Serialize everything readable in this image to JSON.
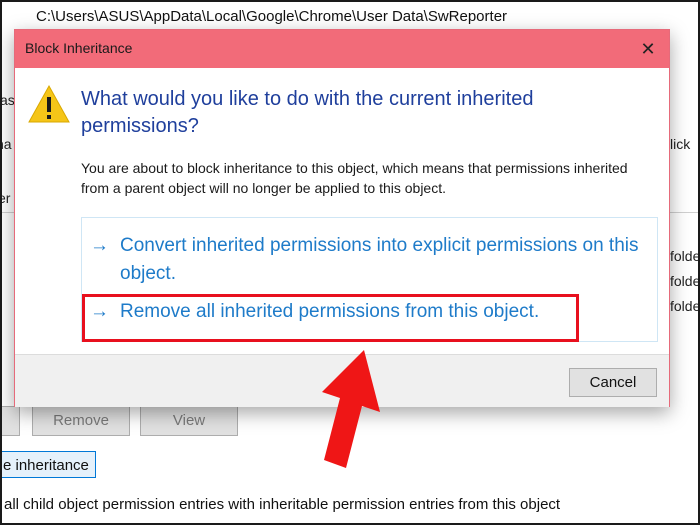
{
  "background_window": {
    "path": "C:\\Users\\ASUS\\AppData\\Local\\Google\\Chrome\\User Data\\SwReporter",
    "fragments": {
      "left_1": "as",
      "left_2": "na",
      "left_3": "er",
      "right_click": "lick",
      "right_folder_1": "folde",
      "right_folder_2": "folde",
      "right_folder_3": "folde"
    },
    "buttons": {
      "remove": "Remove",
      "view": "View",
      "disable_inheritance": "e inheritance"
    },
    "replace_checkbox_label": "all child object permission entries with inheritable permission entries from this object"
  },
  "dialog": {
    "title": "Block Inheritance",
    "close_glyph": "✕",
    "heading": "What would you like to do with the current inherited permissions?",
    "description": "You are about to block inheritance to this object, which means that permissions inherited from a parent object will no longer be applied to this object.",
    "options": [
      {
        "arrow": "→",
        "label": "Convert inherited permissions into explicit permissions on this object."
      },
      {
        "arrow": "→",
        "label": "Remove all inherited permissions from this object."
      }
    ],
    "cancel_label": "Cancel"
  },
  "colors": {
    "titlebar": "#f26b79",
    "heading": "#1f3f9c",
    "command_link": "#1e7bc9",
    "highlight": "#e8101e",
    "warning": "#f5c518"
  }
}
